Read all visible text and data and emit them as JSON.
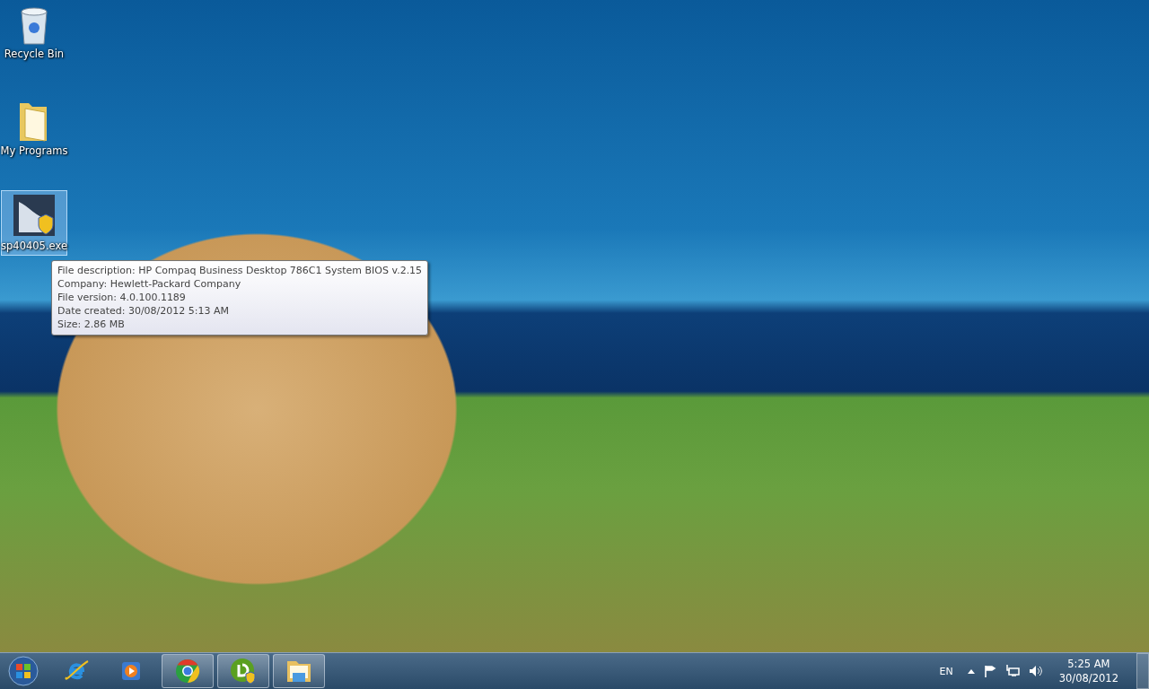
{
  "desktop_icons": [
    {
      "label": "Recycle Bin",
      "kind": "bin",
      "selected": false
    },
    {
      "label": "My Programs",
      "kind": "folder",
      "selected": false
    },
    {
      "label": "sp40405.exe",
      "kind": "installer",
      "selected": true
    }
  ],
  "tooltip": {
    "lines": [
      "File description: HP Compaq Business Desktop 786C1 System BIOS v.2.15",
      "Company: Hewlett-Packard Company",
      "File version: 4.0.100.1189",
      "Date created: 30/08/2012 5:13 AM",
      "Size: 2.86 MB"
    ]
  },
  "taskbar": {
    "items": [
      {
        "kind": "browser-e",
        "running": false
      },
      {
        "kind": "media",
        "running": false
      },
      {
        "kind": "chrome",
        "running": true
      },
      {
        "kind": "setup",
        "running": true
      },
      {
        "kind": "explorer",
        "running": true
      }
    ],
    "language": "EN",
    "time": "5:25 AM",
    "date": "30/08/2012"
  }
}
